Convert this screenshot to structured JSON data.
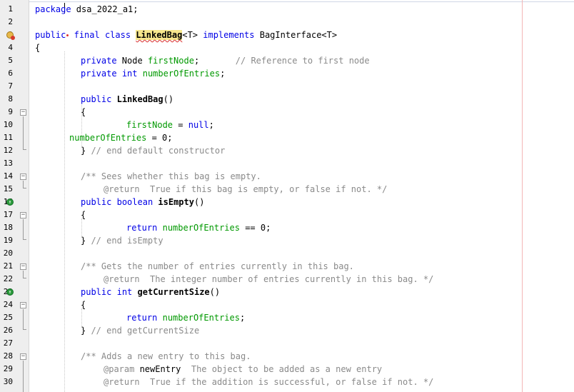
{
  "editor": {
    "lines": [
      {
        "n": "1",
        "t": "package dsa_2022_a1;"
      },
      {
        "n": "2",
        "t": ""
      },
      {
        "n": "3",
        "t": "public final class LinkedBag<T> implements BagInterface<T>"
      },
      {
        "n": "4",
        "t": "{"
      },
      {
        "n": "5",
        "t": "private Node firstNode;       // Reference to first node"
      },
      {
        "n": "6",
        "t": "private int numberOfEntries;"
      },
      {
        "n": "7",
        "t": ""
      },
      {
        "n": "8",
        "t": "public LinkedBag()"
      },
      {
        "n": "9",
        "t": "{"
      },
      {
        "n": "10",
        "t": "firstNode = null;"
      },
      {
        "n": "11",
        "t": "numberOfEntries = 0;"
      },
      {
        "n": "12",
        "t": "} // end default constructor"
      },
      {
        "n": "13",
        "t": ""
      },
      {
        "n": "14",
        "t": "/** Sees whether this bag is empty."
      },
      {
        "n": "15",
        "t": "@return  True if this bag is empty, or false if not. */"
      },
      {
        "n": "16",
        "t": "public boolean isEmpty()"
      },
      {
        "n": "17",
        "t": "{"
      },
      {
        "n": "18",
        "t": "return numberOfEntries == 0;"
      },
      {
        "n": "19",
        "t": "} // end isEmpty"
      },
      {
        "n": "20",
        "t": ""
      },
      {
        "n": "21",
        "t": "/** Gets the number of entries currently in this bag."
      },
      {
        "n": "22",
        "t": "@return  The integer number of entries currently in this bag. */"
      },
      {
        "n": "23",
        "t": "public int getCurrentSize()"
      },
      {
        "n": "24",
        "t": "{"
      },
      {
        "n": "25",
        "t": "return numberOfEntries;"
      },
      {
        "n": "26",
        "t": "} // end getCurrentSize"
      },
      {
        "n": "27",
        "t": ""
      },
      {
        "n": "28",
        "t": "/** Adds a new entry to this bag."
      },
      {
        "n": "29",
        "t": "@param newEntry  The object to be added as a new entry"
      },
      {
        "n": "30",
        "t": "@return  True if the addition is successful, or false if not. */"
      }
    ]
  },
  "colors": {
    "keyword": "#0000e6",
    "field": "#009900",
    "comment": "#8a8a8a",
    "highlight": "#f7e78c",
    "margin_line": "#f3b6b6"
  },
  "icons": {
    "line3": "warning-error-icon",
    "line16": "implements-method-icon",
    "line23": "implements-method-icon"
  }
}
